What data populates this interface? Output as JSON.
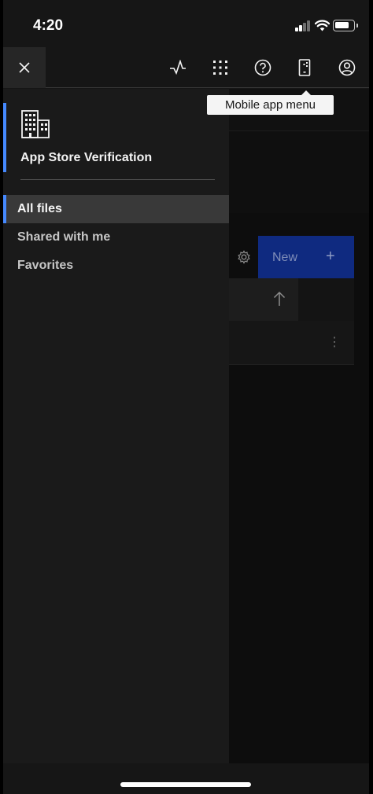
{
  "status_bar": {
    "time": "4:20"
  },
  "header": {
    "close_icon": "close-icon",
    "icons": [
      "activity-icon",
      "app-switcher-icon",
      "help-icon",
      "mobile-app-menu-icon",
      "user-avatar-icon"
    ]
  },
  "tooltip": {
    "text": "Mobile app menu"
  },
  "side_panel": {
    "account_icon": "building-icon",
    "account_name": "App Store Verification",
    "nav_items": [
      {
        "label": "All files",
        "active": true
      },
      {
        "label": "Shared with me",
        "active": false
      },
      {
        "label": "Favorites",
        "active": false
      }
    ]
  },
  "main": {
    "new_button_label": "New",
    "new_button_icon": "+",
    "row_menu_icon": "⋮"
  },
  "colors": {
    "accent": "#4589ff",
    "background": "#161616",
    "panel": "#1a1a1a",
    "primary_button": "#0f62fe"
  }
}
